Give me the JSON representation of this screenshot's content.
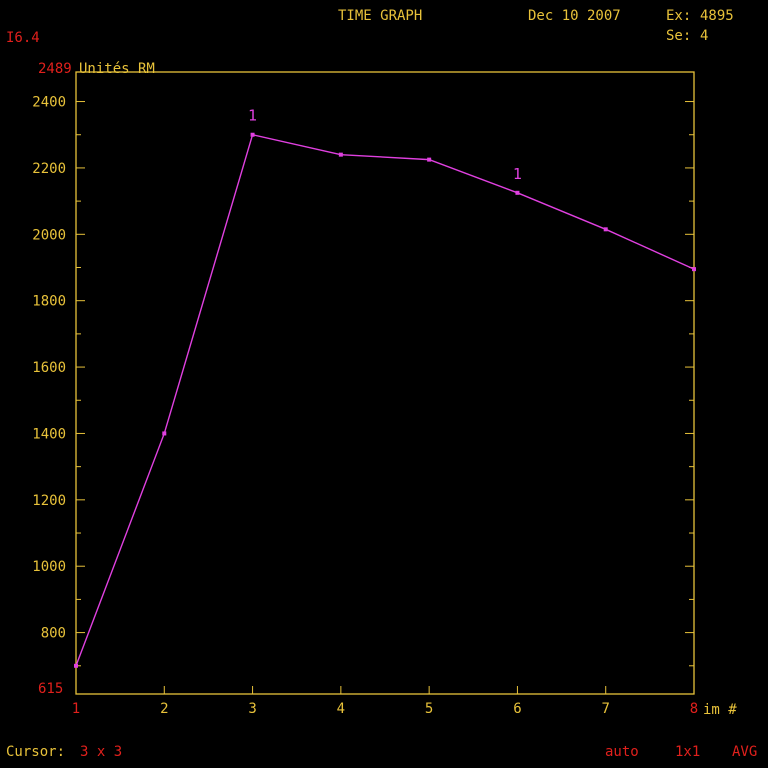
{
  "header": {
    "title": "TIME GRAPH",
    "date": "Dec 10 2007",
    "exam_label": "Ex:",
    "exam_value": "4895",
    "series_label": "Se:",
    "series_value": "4",
    "image_id": "I6.4"
  },
  "footer": {
    "cursor_label": "Cursor:",
    "cursor_value": "3 x 3",
    "mode": "auto",
    "zoom": "1x1",
    "stat": "AVG"
  },
  "colors": {
    "background": "#000000",
    "axis": "#e8c23a",
    "label_yellow": "#e8c23a",
    "label_red": "#e0201c",
    "series": "#e040e0"
  },
  "chart_data": {
    "type": "line",
    "title": "TIME GRAPH",
    "xlabel": "im #",
    "ylabel": "Unités RM",
    "ylabel_value": "2489",
    "ymin_label": "615",
    "xlim": [
      1,
      8
    ],
    "ylim": [
      615,
      2489
    ],
    "x_ticks": [
      1,
      2,
      3,
      4,
      5,
      6,
      7,
      8
    ],
    "y_ticks": [
      800,
      1000,
      1200,
      1400,
      1600,
      1800,
      2000,
      2200,
      2400
    ],
    "series": [
      {
        "label_markers": [
          {
            "x": 3,
            "text": "1"
          },
          {
            "x": 6,
            "text": "1"
          }
        ],
        "x": [
          1,
          2,
          3,
          4,
          5,
          6,
          7,
          8
        ],
        "y": [
          700,
          1400,
          2300,
          2240,
          2225,
          2125,
          2015,
          1895
        ]
      }
    ]
  }
}
